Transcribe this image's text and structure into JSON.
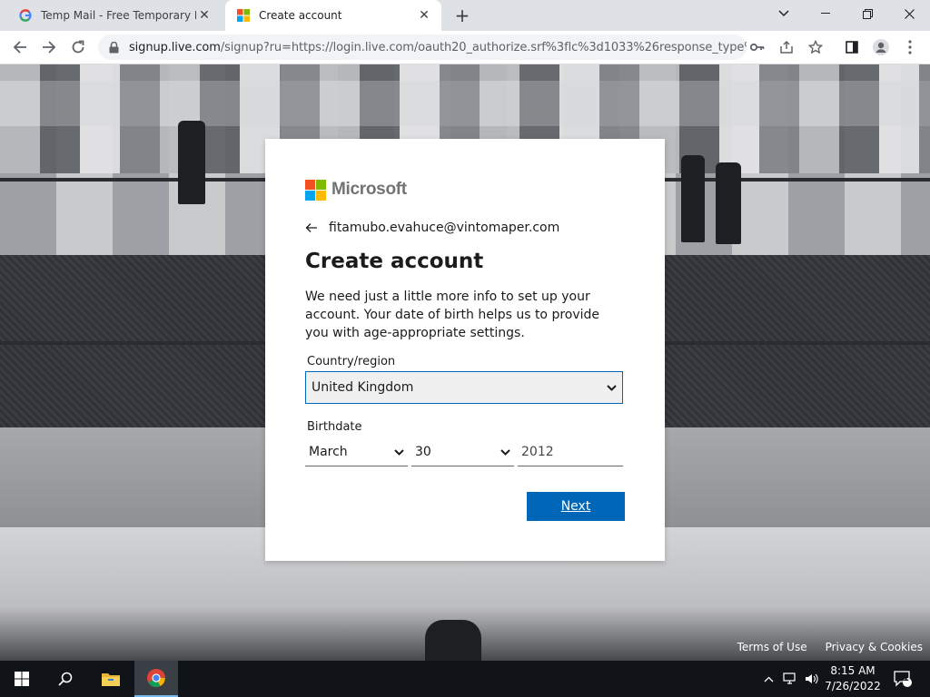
{
  "browser": {
    "tabs": [
      {
        "title": "Temp Mail - Free Temporary Ema",
        "active": false
      },
      {
        "title": "Create account",
        "active": true
      }
    ],
    "url_host": "signup.live.com",
    "url_rest": "/signup?ru=https://login.live.com/oauth20_authorize.srf%3flc%3d1033%26response_type%..."
  },
  "card": {
    "brand": "Microsoft",
    "identity": "fitamubo.evahuce@vintomaper.com",
    "heading": "Create account",
    "description": "We need just a little more info to set up your account. Your date of birth helps us to provide you with age-appropriate settings.",
    "country_label": "Country/region",
    "country_value": "United Kingdom",
    "birthdate_label": "Birthdate",
    "birth_month": "March",
    "birth_day": "30",
    "birth_year": "2012",
    "next_label": "Next"
  },
  "footer": {
    "terms": "Terms of Use",
    "privacy": "Privacy & Cookies"
  },
  "taskbar": {
    "time": "8:15 AM",
    "date": "7/26/2022",
    "notification_count": "1"
  },
  "colors": {
    "accent": "#0067b8",
    "ms_red": "#f25022",
    "ms_green": "#7fba00",
    "ms_blue": "#00a4ef",
    "ms_yellow": "#ffb900"
  }
}
